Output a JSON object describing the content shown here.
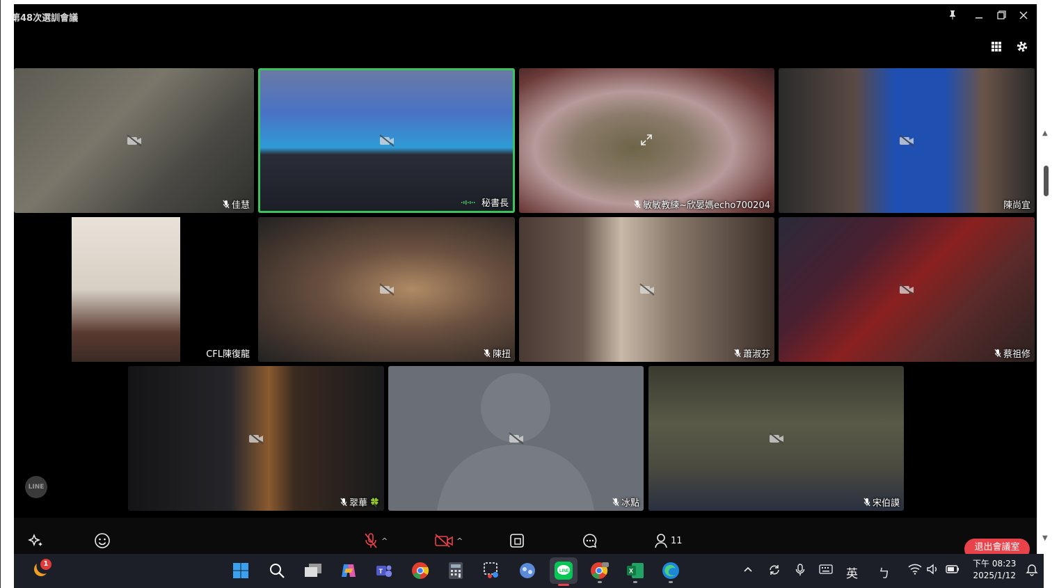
{
  "window": {
    "title": "第48次選訓會議"
  },
  "window_controls": [
    "pin-icon",
    "minimize-icon",
    "restore-icon",
    "close-icon"
  ],
  "top_tools": [
    "grid-view-icon",
    "settings-icon"
  ],
  "participants": [
    {
      "name": "佳慧",
      "muted": true
    },
    {
      "name": "秘書長",
      "muted": false,
      "speaking": true
    },
    {
      "name": "敏敏教練~欣晏媽echo700204",
      "muted": true
    },
    {
      "name": "陳尚宜",
      "muted": false
    },
    {
      "name": "CFL陳復龍",
      "muted": false
    },
    {
      "name": "陳扭",
      "muted": true
    },
    {
      "name": "蕭淑芬",
      "muted": true
    },
    {
      "name": "蔡祖修",
      "muted": true
    },
    {
      "name": "翠華",
      "muted": true,
      "emoji": "🍀"
    },
    {
      "name": "冰點",
      "muted": true
    },
    {
      "name": "宋伯謨",
      "muted": true
    }
  ],
  "controls": {
    "participant_count": "11",
    "leave_label": "退出會議室"
  },
  "watermark": "LINE",
  "taskbar": {
    "apps": [
      "start-icon",
      "search-icon",
      "task-view-icon",
      "copilot-icon",
      "teams-icon",
      "chrome-icon",
      "calculator-icon",
      "snipping-tool-icon",
      "quick-assist-icon",
      "line-app-icon",
      "chrome-beta-icon",
      "excel-icon",
      "edge-icon"
    ],
    "notification_count": "1",
    "ime_lang": "英",
    "ime_mode": "ㄅ",
    "time": "下午 08:23",
    "date": "2025/1/12"
  },
  "colors": {
    "active_speaker_border": "#3ec25d",
    "leave_button": "#e8424a",
    "taskbar": "#1c1f28"
  }
}
